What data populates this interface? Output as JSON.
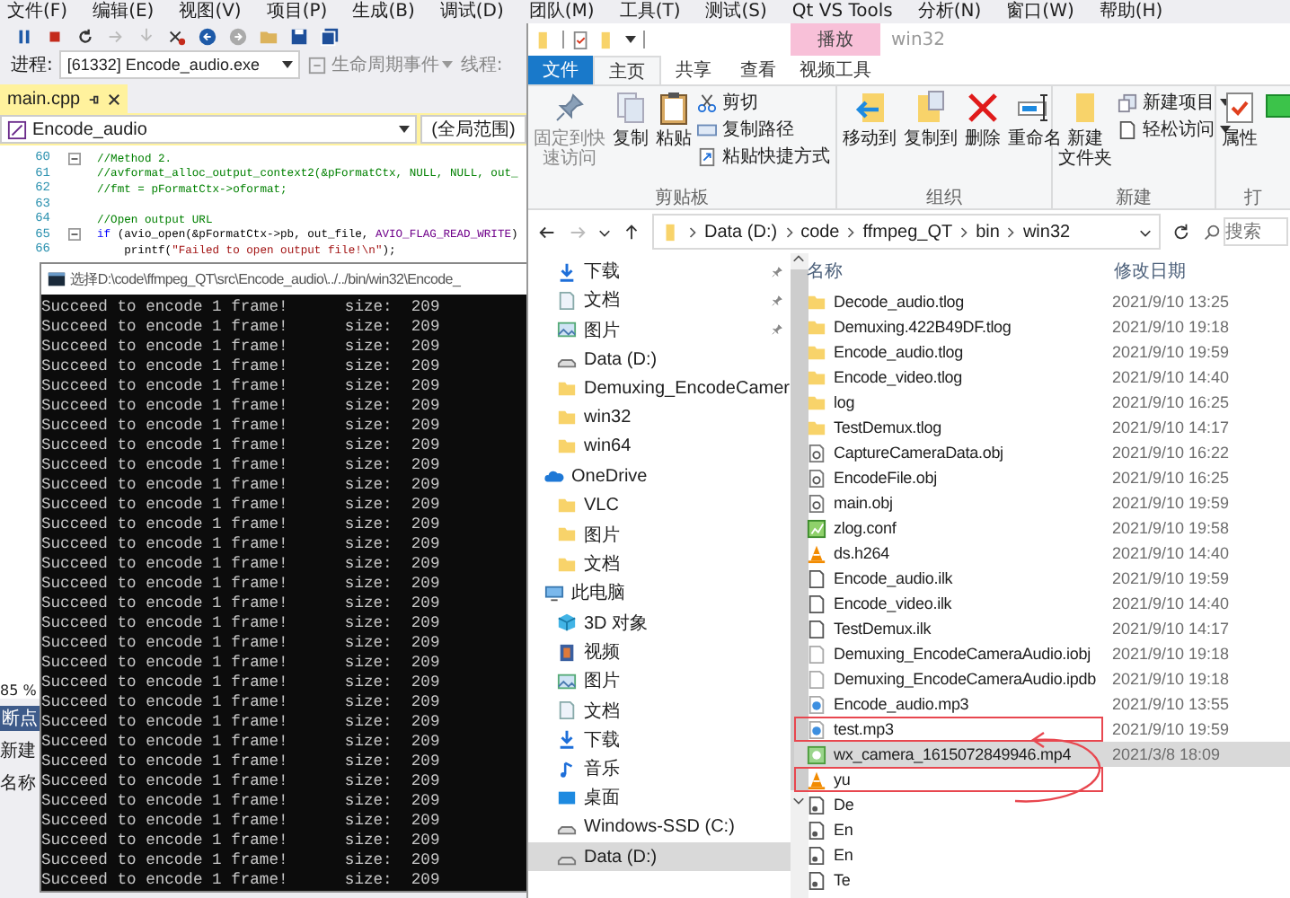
{
  "vs": {
    "menu": [
      "文件(F)",
      "编辑(E)",
      "视图(V)",
      "项目(P)",
      "生成(B)",
      "调试(D)",
      "团队(M)",
      "工具(T)",
      "测试(S)",
      "Qt VS Tools",
      "分析(N)",
      "窗口(W)",
      "帮助(H)"
    ],
    "process_label": "进程:",
    "process": "[61332] Encode_audio.exe",
    "lifecycle": "生命周期事件",
    "thread_label": "线程:",
    "tab": {
      "label": "main.cpp",
      "selected": true
    },
    "scope": "Encode_audio",
    "global_scope": "(全局范围)",
    "code": [
      {
        "number": "60",
        "foldable": true,
        "segments": [
          {
            "kind": "comment",
            "text": "//Method 2."
          }
        ]
      },
      {
        "number": "61",
        "foldable": false,
        "segments": [
          {
            "kind": "comment",
            "text": "//avformat_alloc_output_context2(&pFormatCtx, NULL, NULL, out_"
          }
        ]
      },
      {
        "number": "62",
        "foldable": false,
        "segments": [
          {
            "kind": "comment",
            "text": "//fmt = pFormatCtx->oformat;"
          }
        ]
      },
      {
        "number": "63",
        "foldable": false
      },
      {
        "number": "64",
        "foldable": false,
        "segments": [
          {
            "kind": "comment",
            "text": "//Open output URL"
          }
        ]
      },
      {
        "number": "65",
        "foldable": true,
        "segments": [
          {
            "kind": "keyword",
            "text": "if"
          },
          {
            "kind": "plain",
            "text": " (avio_open(&pFormatCtx->pb, out_file, "
          },
          {
            "kind": "macro",
            "text": "AVIO_FLAG_READ_WRITE"
          },
          {
            "kind": "plain",
            "text": ")"
          }
        ]
      },
      {
        "number": "66",
        "foldable": false,
        "segments": [
          {
            "kind": "plain",
            "text": "    printf("
          },
          {
            "kind": "string",
            "text": "\"Failed to open output file!\\n\""
          },
          {
            "kind": "plain",
            "text": ");"
          }
        ]
      }
    ],
    "zoom": "85 %",
    "panel_tab": "断点",
    "panel_new": "新建",
    "panel_column": "名称"
  },
  "console": {
    "title": "选择D:\\code\\ffmpeg_QT\\src\\Encode_audio\\../../bin/win32\\Encode_",
    "lines": [
      "Succeed to encode 1 frame!      size:  209",
      "Succeed to encode 1 frame!      size:  209",
      "Succeed to encode 1 frame!      size:  209",
      "Succeed to encode 1 frame!      size:  209",
      "Succeed to encode 1 frame!      size:  209",
      "Succeed to encode 1 frame!      size:  209",
      "Succeed to encode 1 frame!      size:  209",
      "Succeed to encode 1 frame!      size:  209",
      "Succeed to encode 1 frame!      size:  209",
      "Succeed to encode 1 frame!      size:  209",
      "Succeed to encode 1 frame!      size:  209",
      "Succeed to encode 1 frame!      size:  209",
      "Succeed to encode 1 frame!      size:  209",
      "Succeed to encode 1 frame!      size:  209",
      "Succeed to encode 1 frame!      size:  209",
      "Succeed to encode 1 frame!      size:  209",
      "Succeed to encode 1 frame!      size:  209",
      "Succeed to encode 1 frame!      size:  209",
      "Succeed to encode 1 frame!      size:  209",
      "Succeed to encode 1 frame!      size:  209",
      "Succeed to encode 1 frame!      size:  209",
      "Succeed to encode 1 frame!      size:  209",
      "Succeed to encode 1 frame!      size:  209",
      "Succeed to encode 1 frame!      size:  209",
      "Succeed to encode 1 frame!      size:  209",
      "Succeed to encode 1 frame!      size:  209",
      "Succeed to encode 1 frame!      size:  209",
      "Succeed to encode 1 frame!      size:  209",
      "Succeed to encode 1 frame!      size:  209",
      "Succeed to encode 1 frame!      size:  209"
    ]
  },
  "explorer": {
    "context_tab": "播放",
    "title": "win32",
    "tabs": [
      {
        "label": "文件",
        "kind": "file",
        "selected": false
      },
      {
        "label": "主页",
        "kind": "tab",
        "selected": true
      },
      {
        "label": "共享",
        "kind": "tab",
        "selected": false
      },
      {
        "label": "查看",
        "kind": "tab",
        "selected": false
      },
      {
        "label": "视频工具",
        "kind": "tab",
        "selected": false
      }
    ],
    "ribbon": {
      "pin": [
        "固定到快",
        "速访问"
      ],
      "copy": "复制",
      "paste": "粘贴",
      "cut": "剪切",
      "copy_path": "复制路径",
      "paste_shortcut": "粘贴快捷方式",
      "clipboard": "剪贴板",
      "move_to": "移动到",
      "copy_to": "复制到",
      "delete": "删除",
      "rename": "重命名",
      "organize": "组织",
      "new_folder": [
        "新建",
        "文件夹"
      ],
      "new_item": "新建项目",
      "easy_access": "轻松访问",
      "new": "新建",
      "properties": "属性",
      "open": "打"
    },
    "path": [
      "Data (D:)",
      "code",
      "ffmpeg_QT",
      "bin",
      "win32"
    ],
    "search": {
      "placeholder": "搜索"
    },
    "quick_access": [
      {
        "label": "下载",
        "kind": "download",
        "pinned": true
      },
      {
        "label": "文档",
        "kind": "doc",
        "pinned": true
      },
      {
        "label": "图片",
        "kind": "pictures",
        "pinned": true
      },
      {
        "label": "Data (D:)",
        "kind": "drive",
        "pinned": false
      },
      {
        "label": "Demuxing_EncodeCamer",
        "kind": "folder",
        "pinned": false
      },
      {
        "label": "win32",
        "kind": "folder",
        "pinned": false
      },
      {
        "label": "win64",
        "kind": "folder",
        "pinned": false
      }
    ],
    "tree": [
      {
        "label": "OneDrive",
        "kind": "cloud",
        "selected": false,
        "children": [
          {
            "label": "VLC",
            "kind": "folder",
            "selected": false
          },
          {
            "label": "图片",
            "kind": "folder",
            "selected": false
          },
          {
            "label": "文档",
            "kind": "folder",
            "selected": false
          }
        ]
      },
      {
        "label": "此电脑",
        "kind": "pc",
        "selected": false,
        "children": [
          {
            "label": "3D 对象",
            "kind": "cube",
            "selected": false
          },
          {
            "label": "视频",
            "kind": "video",
            "selected": false
          },
          {
            "label": "图片",
            "kind": "pictures",
            "selected": false
          },
          {
            "label": "文档",
            "kind": "doc",
            "selected": false
          },
          {
            "label": "下载",
            "kind": "download",
            "selected": false
          },
          {
            "label": "音乐",
            "kind": "music",
            "selected": false
          },
          {
            "label": "桌面",
            "kind": "desktop",
            "selected": false
          },
          {
            "label": "Windows-SSD (C:)",
            "kind": "drive",
            "selected": false
          },
          {
            "label": "Data (D:)",
            "kind": "drive",
            "selected": true
          }
        ]
      }
    ],
    "columns": [
      "名称",
      "修改日期"
    ],
    "files": [
      {
        "name": "Decode_audio.tlog",
        "date": "2021/9/10 13:25",
        "kind": "folder",
        "selected": false,
        "marked": false
      },
      {
        "name": "Demuxing.422B49DF.tlog",
        "date": "2021/9/10 19:18",
        "kind": "folder",
        "selected": false,
        "marked": false
      },
      {
        "name": "Encode_audio.tlog",
        "date": "2021/9/10 19:59",
        "kind": "folder",
        "selected": false,
        "marked": false
      },
      {
        "name": "Encode_video.tlog",
        "date": "2021/9/10 14:40",
        "kind": "folder",
        "selected": false,
        "marked": false
      },
      {
        "name": "log",
        "date": "2021/9/10 16:25",
        "kind": "folder",
        "selected": false,
        "marked": false
      },
      {
        "name": "TestDemux.tlog",
        "date": "2021/9/10 14:17",
        "kind": "folder",
        "selected": false,
        "marked": false
      },
      {
        "name": "CaptureCameraData.obj",
        "date": "2021/9/10 16:22",
        "kind": "obj",
        "selected": false,
        "marked": false
      },
      {
        "name": "EncodeFile.obj",
        "date": "2021/9/10 16:25",
        "kind": "obj",
        "selected": false,
        "marked": false
      },
      {
        "name": "main.obj",
        "date": "2021/9/10 19:59",
        "kind": "obj",
        "selected": false,
        "marked": false
      },
      {
        "name": "zlog.conf",
        "date": "2021/9/10 19:58",
        "kind": "conf",
        "selected": false,
        "marked": false
      },
      {
        "name": "ds.h264",
        "date": "2021/9/10 14:40",
        "kind": "cone",
        "selected": false,
        "marked": false
      },
      {
        "name": "Encode_audio.ilk",
        "date": "2021/9/10 19:59",
        "kind": "page",
        "selected": false,
        "marked": false
      },
      {
        "name": "Encode_video.ilk",
        "date": "2021/9/10 14:40",
        "kind": "page",
        "selected": false,
        "marked": false
      },
      {
        "name": "TestDemux.ilk",
        "date": "2021/9/10 14:17",
        "kind": "page",
        "selected": false,
        "marked": false
      },
      {
        "name": "Demuxing_EncodeCameraAudio.iobj",
        "date": "2021/9/10 19:18",
        "kind": "blank",
        "selected": false,
        "marked": false
      },
      {
        "name": "Demuxing_EncodeCameraAudio.ipdb",
        "date": "2021/9/10 19:18",
        "kind": "blank",
        "selected": false,
        "marked": false
      },
      {
        "name": "Encode_audio.mp3",
        "date": "2021/9/10 13:55",
        "kind": "audio",
        "selected": false,
        "marked": false
      },
      {
        "name": "test.mp3",
        "date": "2021/9/10 19:59",
        "kind": "audio",
        "selected": false,
        "marked": true
      },
      {
        "name": "wx_camera_1615072849946.mp4",
        "date": "2021/3/8 18:09",
        "kind": "video",
        "selected": true,
        "marked": false
      },
      {
        "name": "yu",
        "kind": "cone",
        "selected": false,
        "marked": true
      },
      {
        "name": "De",
        "kind": "media",
        "selected": false,
        "marked": false
      },
      {
        "name": "En",
        "kind": "media",
        "selected": false,
        "marked": false
      },
      {
        "name": "En",
        "kind": "media",
        "selected": false,
        "marked": false
      },
      {
        "name": "Te",
        "kind": "media",
        "selected": false,
        "marked": false
      }
    ]
  }
}
